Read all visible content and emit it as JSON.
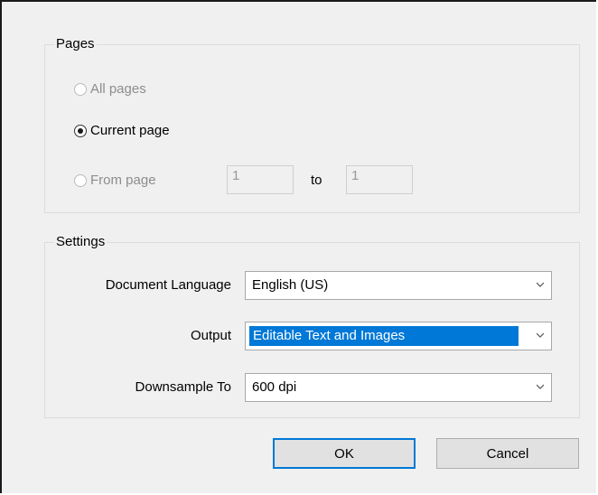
{
  "pages": {
    "group_title": "Pages",
    "all_pages_label": "All pages",
    "current_page_label": "Current page",
    "from_page_label": "From page",
    "to_label": "to",
    "from_value": "1",
    "to_value": "1"
  },
  "settings": {
    "group_title": "Settings",
    "document_language_label": "Document Language",
    "document_language_value": "English (US)",
    "output_label": "Output",
    "output_value": "Editable Text and Images",
    "downsample_label": "Downsample To",
    "downsample_value": "600 dpi"
  },
  "buttons": {
    "ok_label": "OK",
    "cancel_label": "Cancel"
  },
  "icons": {
    "dropdown": "chevron-down-icon"
  },
  "colors": {
    "accent": "#0078d7",
    "dialog_bg": "#f0f0f0"
  }
}
